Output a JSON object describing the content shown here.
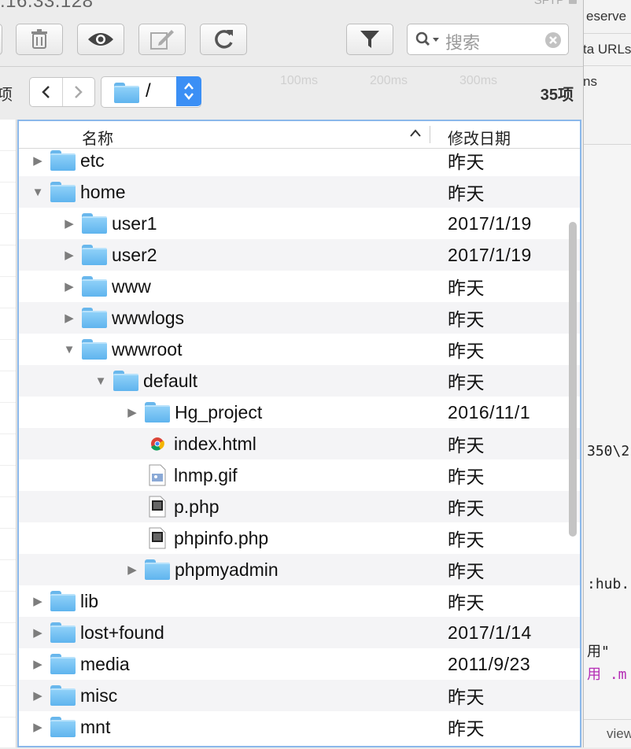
{
  "window": {
    "host_fragment": ".16.33.128",
    "protocol_badge": "SFTP"
  },
  "toolbar": {
    "buttons": [
      "delete-icon",
      "eye-icon",
      "edit-icon",
      "refresh-icon",
      "filter-icon"
    ],
    "search_placeholder": "搜索"
  },
  "navbar": {
    "left_label": "项",
    "path": "/",
    "item_count": "35项"
  },
  "columns": {
    "name": "名称",
    "date": "修改日期"
  },
  "rows": [
    {
      "name": "etc",
      "date": "昨天",
      "type": "folder",
      "depth": 0,
      "expanded": false
    },
    {
      "name": "home",
      "date": "昨天",
      "type": "folder",
      "depth": 0,
      "expanded": true
    },
    {
      "name": "user1",
      "date": "2017/1/19",
      "type": "folder",
      "depth": 1,
      "expanded": false
    },
    {
      "name": "user2",
      "date": "2017/1/19",
      "type": "folder",
      "depth": 1,
      "expanded": false
    },
    {
      "name": "www",
      "date": "昨天",
      "type": "folder",
      "depth": 1,
      "expanded": false
    },
    {
      "name": "wwwlogs",
      "date": "昨天",
      "type": "folder",
      "depth": 1,
      "expanded": false
    },
    {
      "name": "wwwroot",
      "date": "昨天",
      "type": "folder",
      "depth": 1,
      "expanded": true
    },
    {
      "name": "default",
      "date": "昨天",
      "type": "folder",
      "depth": 2,
      "expanded": true
    },
    {
      "name": "Hg_project",
      "date": "2016/11/1",
      "type": "folder",
      "depth": 3,
      "expanded": false
    },
    {
      "name": "index.html",
      "date": "昨天",
      "type": "html",
      "depth": 3
    },
    {
      "name": "lnmp.gif",
      "date": "昨天",
      "type": "image",
      "depth": 3
    },
    {
      "name": "p.php",
      "date": "昨天",
      "type": "php",
      "depth": 3
    },
    {
      "name": "phpinfo.php",
      "date": "昨天",
      "type": "php",
      "depth": 3
    },
    {
      "name": "phpmyadmin",
      "date": "昨天",
      "type": "folder",
      "depth": 3,
      "expanded": false
    },
    {
      "name": "lib",
      "date": "昨天",
      "type": "folder",
      "depth": 0,
      "expanded": false
    },
    {
      "name": "lost+found",
      "date": "2017/1/14",
      "type": "folder",
      "depth": 0,
      "expanded": false
    },
    {
      "name": "media",
      "date": "2011/9/23",
      "type": "folder",
      "depth": 0,
      "expanded": false
    },
    {
      "name": "misc",
      "date": "昨天",
      "type": "folder",
      "depth": 0,
      "expanded": false
    },
    {
      "name": "mnt",
      "date": "昨天",
      "type": "folder",
      "depth": 0,
      "expanded": false
    }
  ],
  "background": {
    "strip1": "eserve",
    "strip2": "ta URLs",
    "strip3": "ns",
    "timeline_ticks": [
      "100ms",
      "200ms",
      "300ms"
    ],
    "code_lines": [
      "350\\2",
      ":hub.",
      "用\"",
      "用 .m"
    ],
    "footer": "view"
  },
  "colors": {
    "accent": "#3b8ff5",
    "folder": "#6dbdf2",
    "selection_border": "#8bb8ea"
  }
}
